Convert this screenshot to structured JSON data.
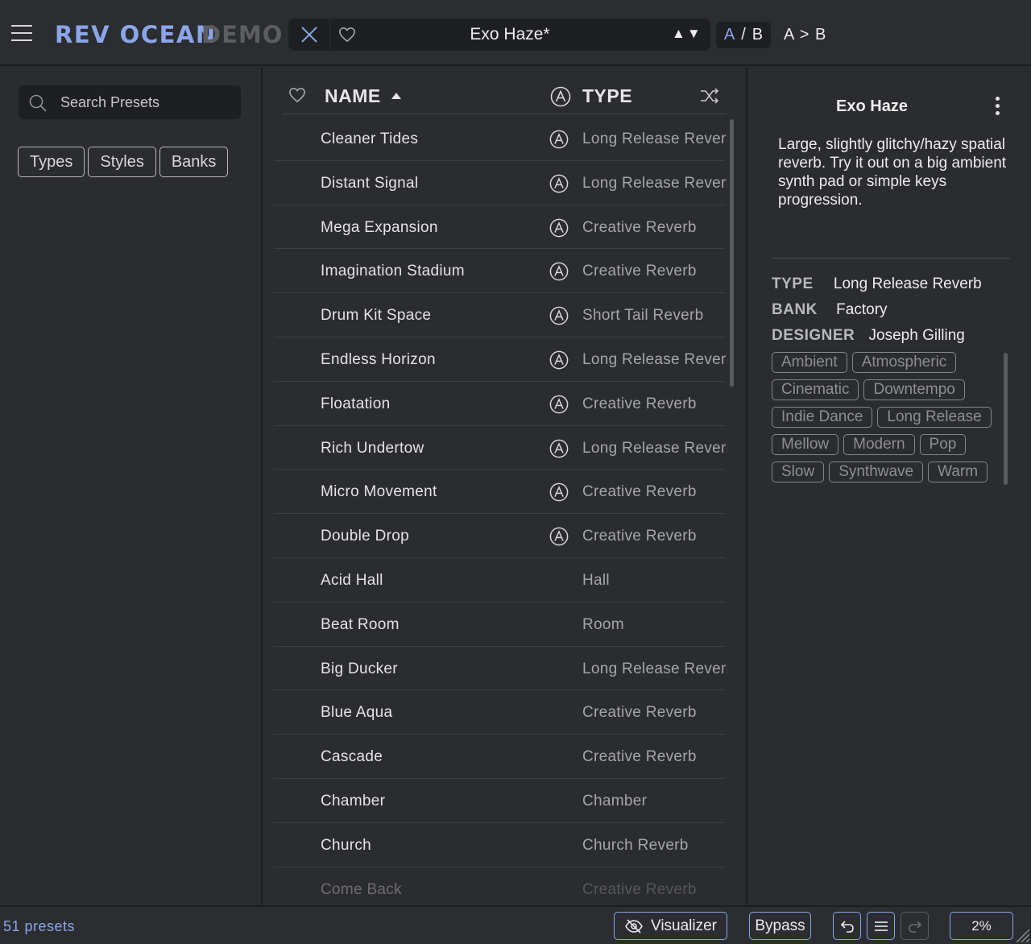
{
  "header": {
    "brand": "REV OCEAN",
    "demo": "DEMO",
    "preset_name": "Exo Haze*",
    "nav_arrows": "▲▼",
    "ab_a": "A",
    "ab_slash": "/",
    "ab_b": "B",
    "ab_copy": "A > B"
  },
  "sidebar": {
    "search_placeholder": "Search Presets",
    "filters": [
      "Types",
      "Styles",
      "Banks"
    ]
  },
  "list": {
    "header_name": "NAME",
    "header_type": "TYPE",
    "rows": [
      {
        "name": "Cleaner Tides",
        "type": "Long Release Reverb",
        "factory": true
      },
      {
        "name": "Distant Signal",
        "type": "Long Release Reverb",
        "factory": true
      },
      {
        "name": "Mega Expansion",
        "type": "Creative Reverb",
        "factory": true
      },
      {
        "name": "Imagination Stadium",
        "type": "Creative Reverb",
        "factory": true
      },
      {
        "name": "Drum Kit Space",
        "type": "Short Tail Reverb",
        "factory": true
      },
      {
        "name": "Endless Horizon",
        "type": "Long Release Reverb",
        "factory": true
      },
      {
        "name": "Floatation",
        "type": "Creative Reverb",
        "factory": true
      },
      {
        "name": "Rich Undertow",
        "type": "Long Release Reverb",
        "factory": true
      },
      {
        "name": "Micro Movement",
        "type": "Creative Reverb",
        "factory": true
      },
      {
        "name": "Double Drop",
        "type": "Creative Reverb",
        "factory": true
      },
      {
        "name": "Acid Hall",
        "type": "Hall",
        "factory": false
      },
      {
        "name": "Beat Room",
        "type": "Room",
        "factory": false
      },
      {
        "name": "Big Ducker",
        "type": "Long Release Reverb",
        "factory": false
      },
      {
        "name": "Blue Aqua",
        "type": "Creative Reverb",
        "factory": false
      },
      {
        "name": "Cascade",
        "type": "Creative Reverb",
        "factory": false
      },
      {
        "name": "Chamber",
        "type": "Chamber",
        "factory": false
      },
      {
        "name": "Church",
        "type": "Church Reverb",
        "factory": false
      },
      {
        "name": "Come Back",
        "type": "Creative Reverb",
        "factory": false
      }
    ]
  },
  "detail": {
    "title": "Exo Haze",
    "description": "Large, slightly glitchy/hazy spatial reverb. Try it out on a big ambient synth pad or simple keys progression.",
    "type_label": "TYPE",
    "type_value": "Long Release Reverb",
    "bank_label": "BANK",
    "bank_value": "Factory",
    "designer_label": "DESIGNER",
    "designer_value": "Joseph Gilling",
    "tags": [
      "Ambient",
      "Atmospheric",
      "Cinematic",
      "Downtempo",
      "Indie Dance",
      "Long Release",
      "Mellow",
      "Modern",
      "Pop",
      "Slow",
      "Synthwave",
      "Warm"
    ]
  },
  "status": {
    "count": "51 presets",
    "visualizer": "Visualizer",
    "bypass": "Bypass",
    "cpu": "2%"
  },
  "colors": {
    "accent": "#8aa6e8",
    "background": "#2b2c30",
    "field": "#1e1f22"
  }
}
